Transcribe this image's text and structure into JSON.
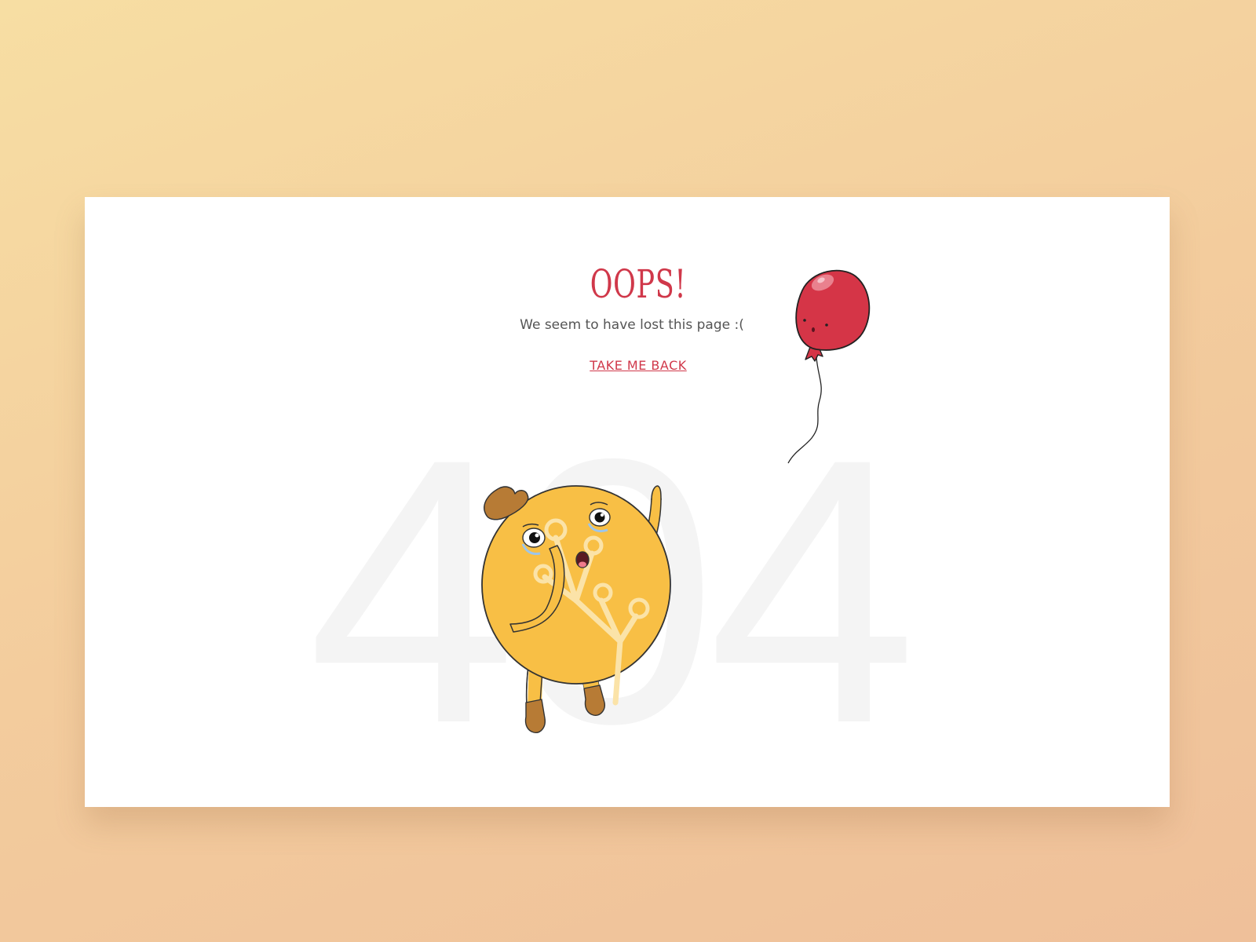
{
  "page": {
    "background_number": "404",
    "title": "OOPS!",
    "subtitle": "We seem to have lost this page :(",
    "back_link": "TAKE ME BACK"
  },
  "colors": {
    "accent": "#d0384a",
    "text": "#555555",
    "character": "#f8bf45",
    "hat": "#b77b35",
    "balloon": "#d53547",
    "background_gradient_start": "#f7dea3",
    "background_gradient_end": "#efc09a"
  },
  "illustrations": {
    "balloon": "red-balloon-illustration",
    "character": "crying-yellow-character-illustration"
  }
}
